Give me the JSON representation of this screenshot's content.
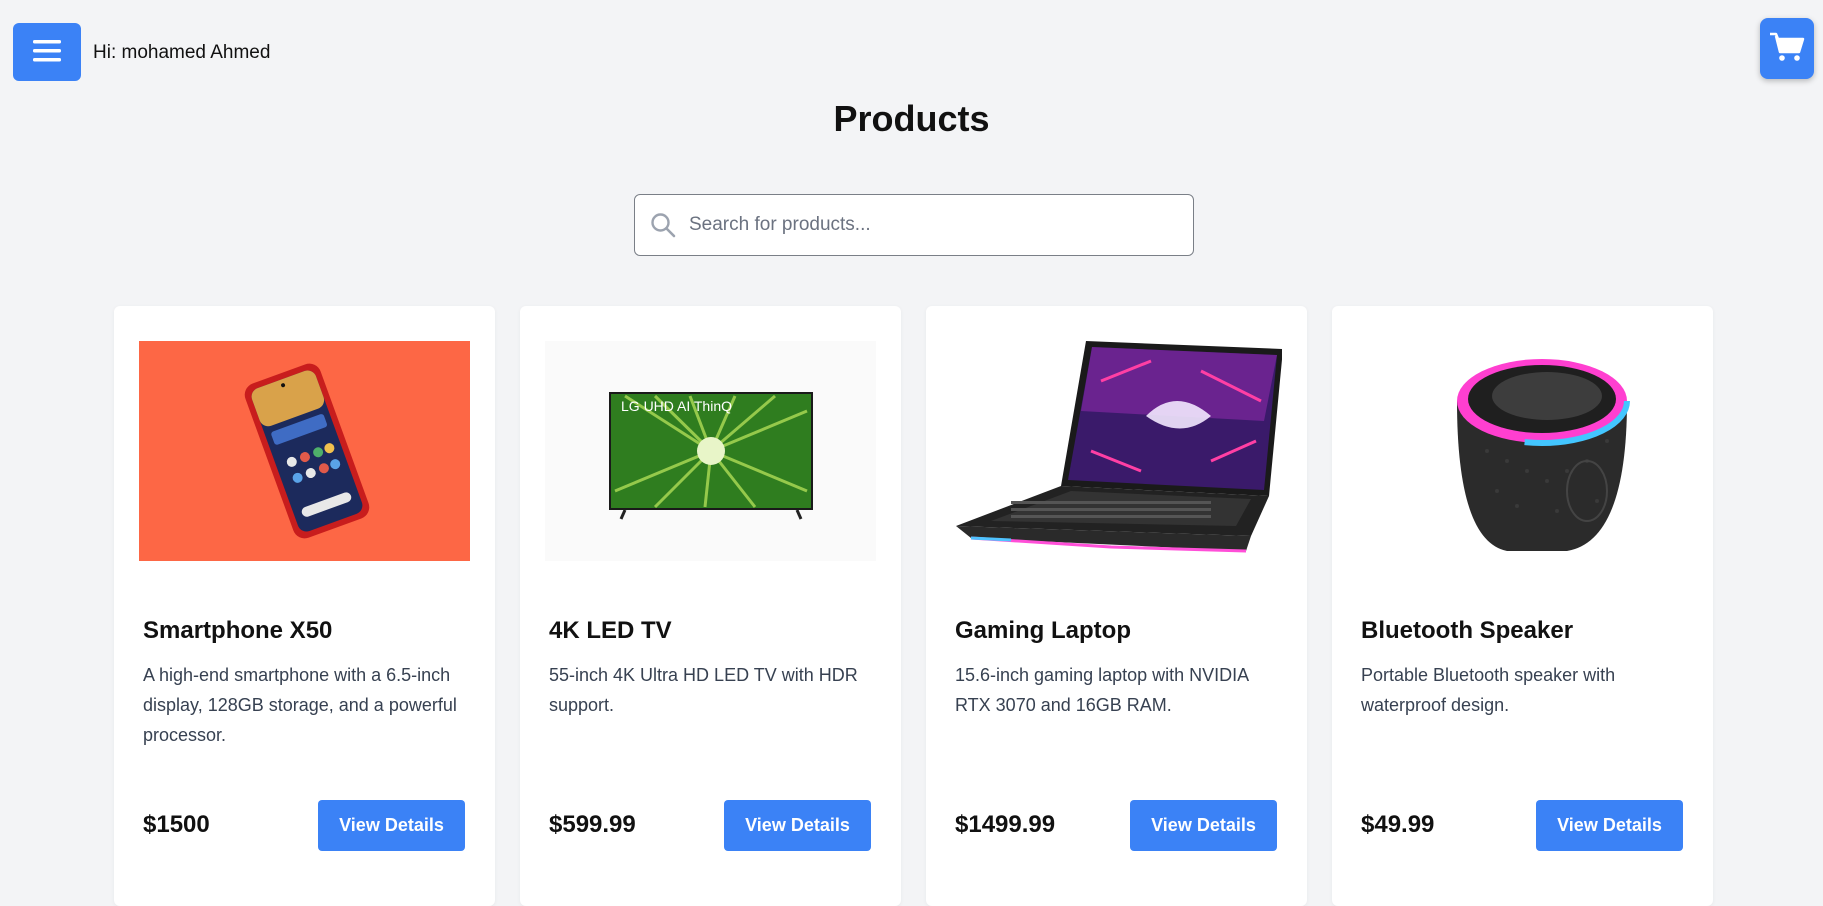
{
  "header": {
    "greeting": "Hi: mohamed Ahmed",
    "menu_icon": "hamburger-menu-icon",
    "cart_icon": "shopping-cart-icon"
  },
  "page": {
    "title": "Products"
  },
  "search": {
    "placeholder": "Search for products...",
    "icon": "search-icon"
  },
  "colors": {
    "accent": "#3b82f6",
    "background": "#f3f4f6"
  },
  "products": [
    {
      "title": "Smartphone X50",
      "description": "A high-end smartphone with a 6.5-inch display, 128GB storage, and a powerful processor.",
      "price": "$1500",
      "button_label": "View Details",
      "image": "smartphone-image"
    },
    {
      "title": "4K LED TV",
      "description": "55-inch 4K Ultra HD LED TV with HDR support.",
      "price": "$599.99",
      "button_label": "View Details",
      "image": "tv-image",
      "image_text": "LG UHD AI ThinQ"
    },
    {
      "title": "Gaming Laptop",
      "description": "15.6-inch gaming laptop with NVIDIA RTX 3070 and 16GB RAM.",
      "price": "$1499.99",
      "button_label": "View Details",
      "image": "laptop-image"
    },
    {
      "title": "Bluetooth Speaker",
      "description": "Portable Bluetooth speaker with waterproof design.",
      "price": "$49.99",
      "button_label": "View Details",
      "image": "speaker-image"
    }
  ]
}
